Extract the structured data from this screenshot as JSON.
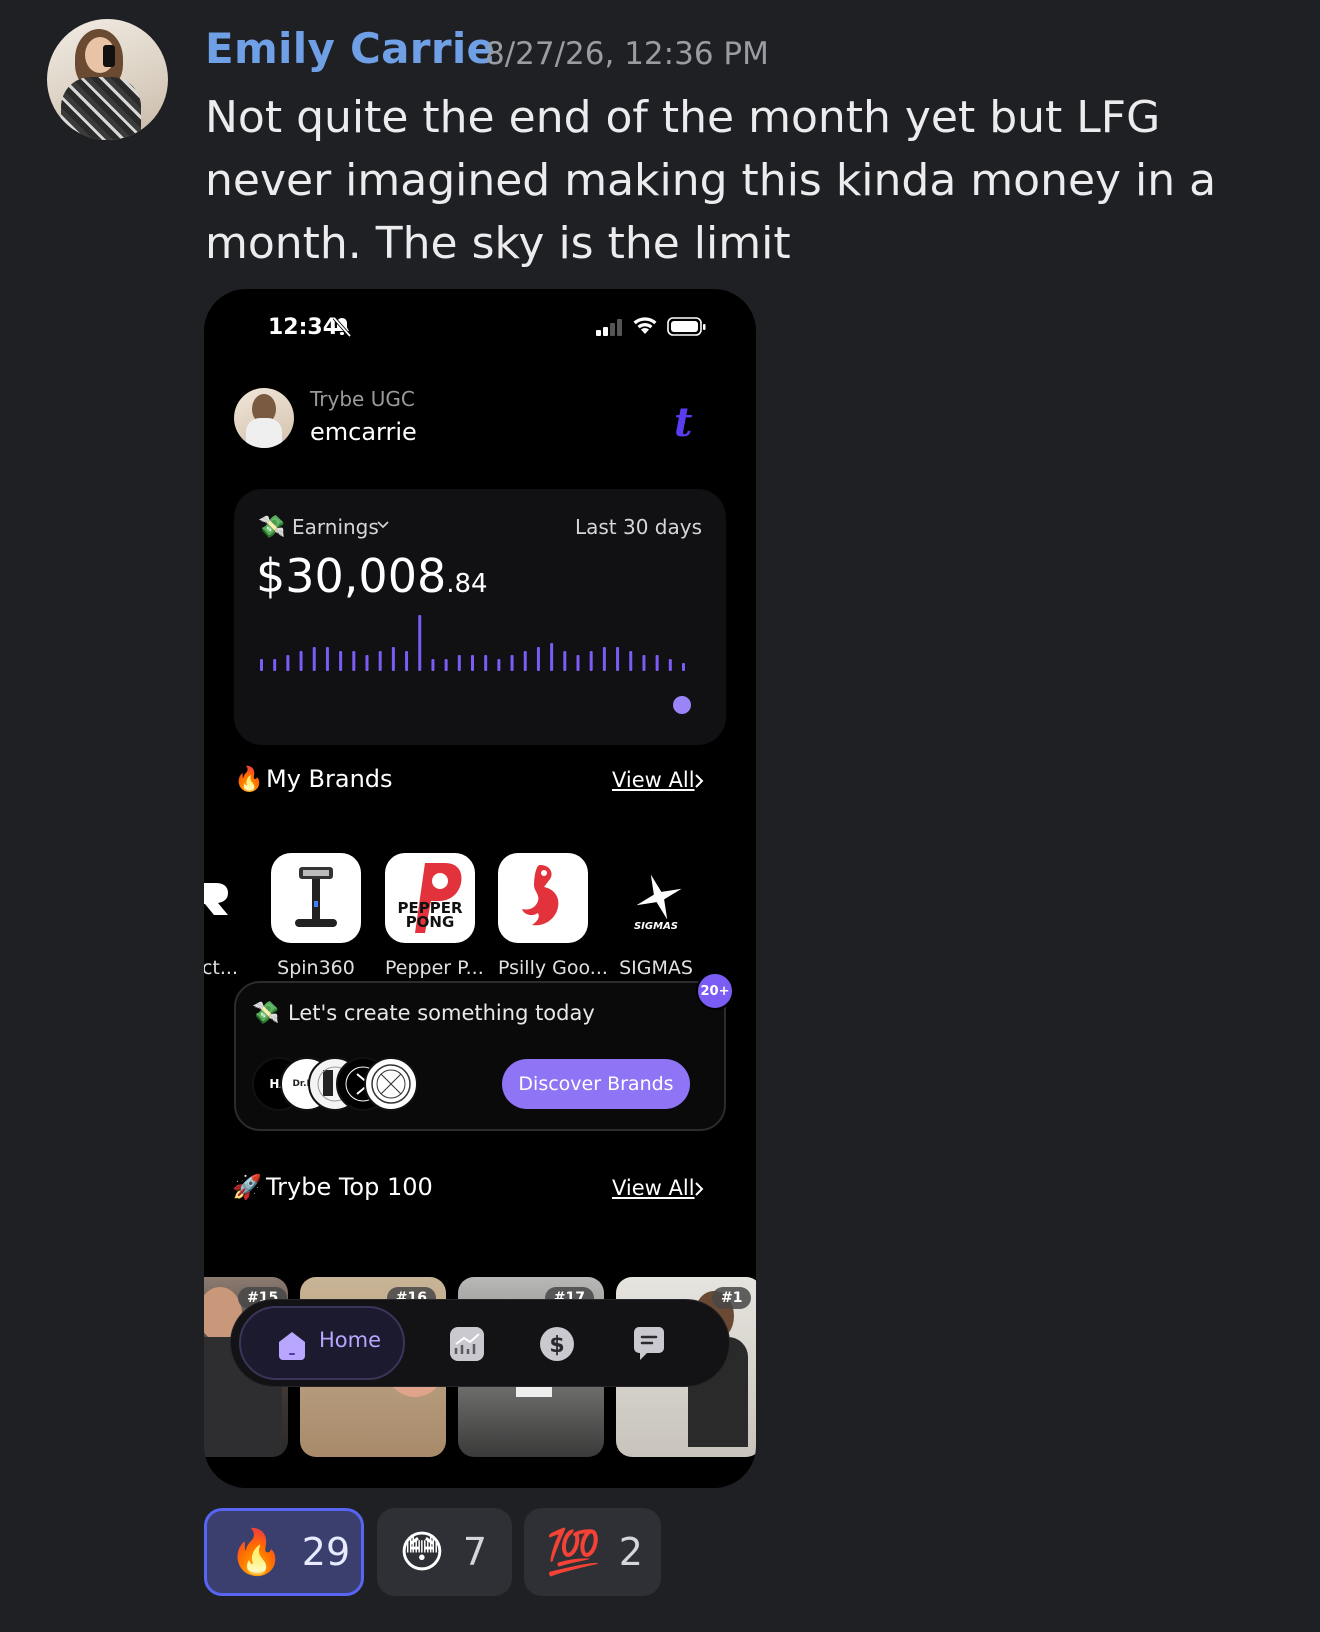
{
  "message": {
    "author": "Emily Carrie",
    "timestamp": "8/27/26, 12:36 PM",
    "text": "Not quite the end of the month yet but LFG never imagined making this kinda money in a month. The sky is the limit"
  },
  "phone": {
    "status_time": "12:34",
    "header": {
      "app_name": "Trybe UGC",
      "username": "emcarrie",
      "logo": "t"
    },
    "earnings": {
      "label": "Earnings",
      "range": "Last 30 days",
      "amount_main": "$30,008",
      "amount_cents": ".84",
      "accent": "#7b5cf5",
      "bar_levels": [
        3,
        3,
        4,
        5,
        6,
        6,
        5,
        5,
        4,
        5,
        6,
        5,
        14,
        3,
        3,
        4,
        4,
        4,
        3,
        4,
        5,
        6,
        7,
        5,
        4,
        5,
        6,
        6,
        5,
        4,
        4,
        3,
        2
      ]
    },
    "brands_section": {
      "title": "My Brands",
      "view_all": "View All",
      "items": [
        {
          "name": "r Act..."
        },
        {
          "name": "Spin360"
        },
        {
          "name": "Pepper P..."
        },
        {
          "name": "Psilly Goo..."
        },
        {
          "name": "SIGMAS"
        }
      ]
    },
    "create_card": {
      "text": "Let's create something today",
      "badge": "20+",
      "button": "Discover Brands",
      "stack_labels": [
        "HA",
        "Dr.Me"
      ]
    },
    "top_section": {
      "title": "Trybe Top 100",
      "view_all": "View All",
      "ranks": [
        "#15",
        "#16",
        "#17",
        "#1"
      ]
    },
    "nav": {
      "home": "Home"
    }
  },
  "reactions": [
    {
      "emoji": "🔥",
      "count": "29",
      "active": true
    },
    {
      "emoji": "😳",
      "count": "7",
      "active": false
    },
    {
      "emoji": "💯",
      "count": "2",
      "active": false
    }
  ]
}
